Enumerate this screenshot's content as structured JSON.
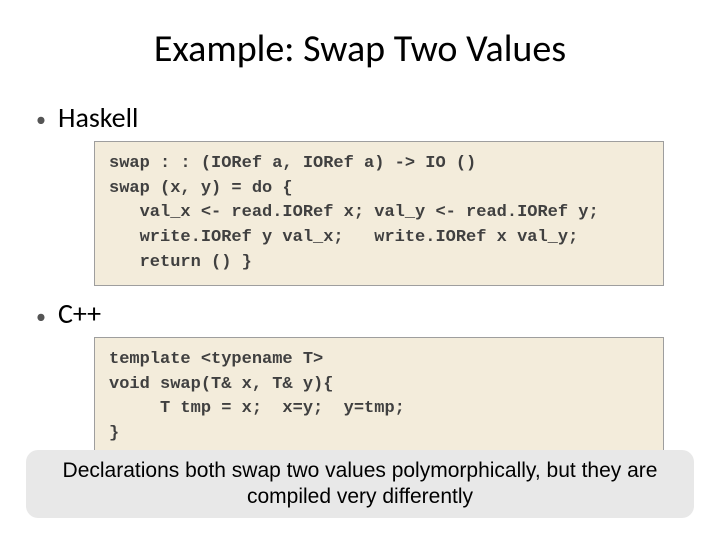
{
  "title": "Example: Swap Two Values",
  "bullets": {
    "haskell": "Haskell",
    "cpp": "C++"
  },
  "code": {
    "haskell": "swap : : (IORef a, IORef a) -> IO ()\nswap (x, y) = do {\n   val_x <- read.IORef x; val_y <- read.IORef y;\n   write.IORef y val_x;   write.IORef x val_y;\n   return () }",
    "cpp": "template <typename T>\nvoid swap(T& x, T& y){\n     T tmp = x;  x=y;  y=tmp;\n}"
  },
  "caption": "Declarations  both swap two values polymorphically, but they are compiled very differently"
}
